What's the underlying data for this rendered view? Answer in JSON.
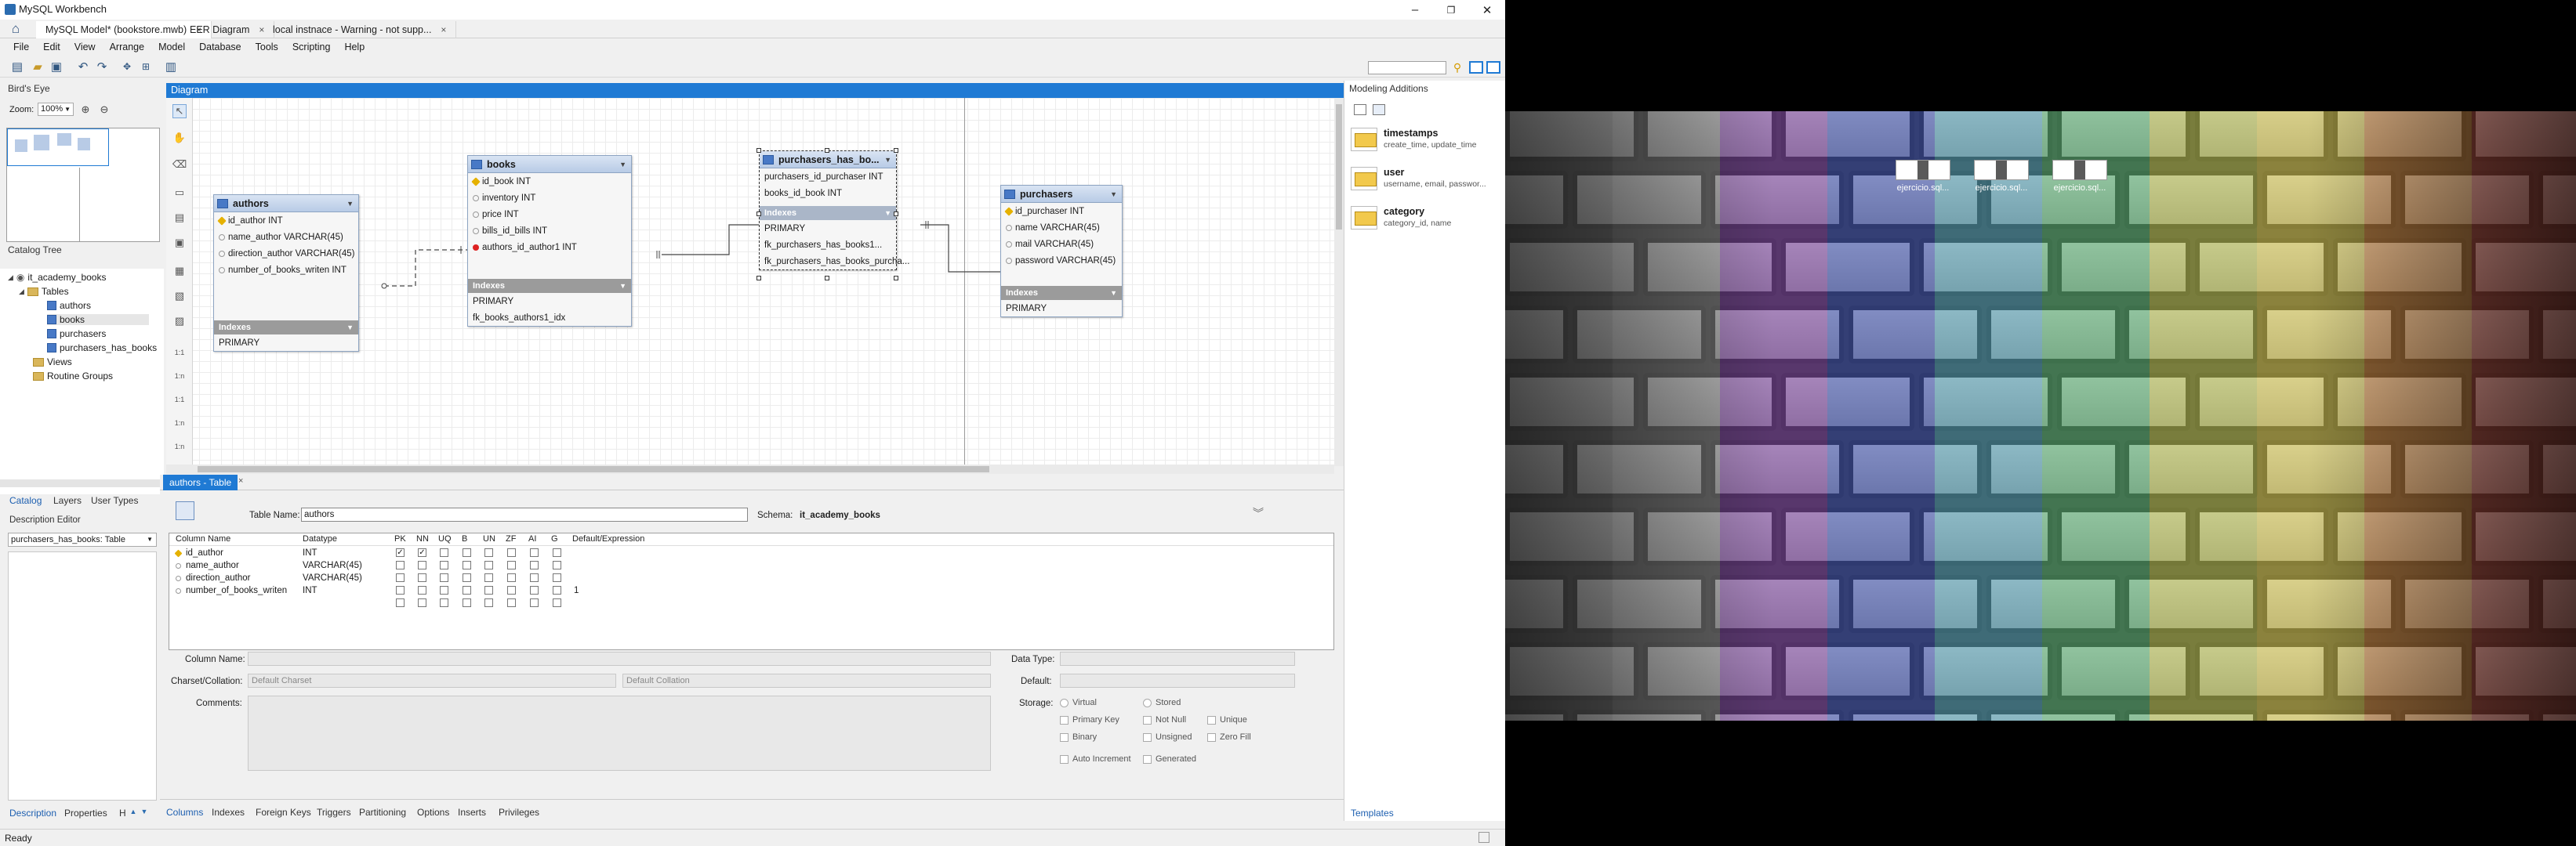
{
  "app": {
    "title": "MySQL Workbench"
  },
  "window_controls": {
    "minimize": "–",
    "restore": "❐",
    "close": "✕"
  },
  "doc_tabs": [
    {
      "label": "MySQL Model* (bookstore.mwb)",
      "close": "×"
    },
    {
      "label": "EER Diagram",
      "close": "×"
    },
    {
      "label": "local instnace - Warning - not supp...",
      "close": "×"
    }
  ],
  "menu": [
    "File",
    "Edit",
    "View",
    "Arrange",
    "Model",
    "Database",
    "Tools",
    "Scripting",
    "Help"
  ],
  "left": {
    "birds_eye_title": "Bird's Eye",
    "zoom_label": "Zoom:",
    "zoom_value": "100%",
    "catalog_title": "Catalog Tree",
    "tree": {
      "schema": "it_academy_books",
      "tables_folder": "Tables",
      "tables": [
        "authors",
        "books",
        "purchasers",
        "purchasers_has_books"
      ],
      "views": "Views",
      "routines": "Routine Groups"
    },
    "tabs": [
      "Catalog",
      "Layers",
      "User Types"
    ],
    "description_title": "Description Editor",
    "description_select": "purchasers_has_books: Table",
    "bottom_tabs": [
      "Description",
      "Properties",
      "H"
    ]
  },
  "diagram": {
    "title": "Diagram",
    "tables": {
      "authors": {
        "name": "authors",
        "columns": [
          "id_author INT",
          "name_author VARCHAR(45)",
          "direction_author VARCHAR(45)",
          "number_of_books_writen INT"
        ],
        "indexes_label": "Indexes",
        "indexes": [
          "PRIMARY"
        ]
      },
      "books": {
        "name": "books",
        "columns": [
          "id_book INT",
          "inventory INT",
          "price INT",
          "bills_id_bills INT",
          "authors_id_author1 INT"
        ],
        "indexes_label": "Indexes",
        "indexes": [
          "PRIMARY",
          "fk_books_authors1_idx"
        ]
      },
      "phb": {
        "name": "purchasers_has_bo...",
        "columns": [
          "purchasers_id_purchaser INT",
          "books_id_book INT"
        ],
        "indexes_label": "Indexes",
        "indexes": [
          "PRIMARY",
          "fk_purchasers_has_books1...",
          "fk_purchasers_has_books_purcha..."
        ]
      },
      "purchasers": {
        "name": "purchasers",
        "columns": [
          "id_purchaser INT",
          "name VARCHAR(45)",
          "mail VARCHAR(45)",
          "password VARCHAR(45)"
        ],
        "indexes_label": "Indexes",
        "indexes": [
          "PRIMARY"
        ]
      }
    },
    "rel_labels": [
      "1:1",
      "1:1",
      "1:n",
      "1:n",
      "1:n"
    ]
  },
  "editor": {
    "tab_label": "authors - Table",
    "table_name_label": "Table Name:",
    "table_name_value": "authors",
    "schema_label": "Schema:",
    "schema_value": "it_academy_books",
    "grid_headers": [
      "Column Name",
      "Datatype",
      "PK",
      "NN",
      "UQ",
      "B",
      "UN",
      "ZF",
      "AI",
      "G",
      "Default/Expression"
    ],
    "rows": [
      {
        "name": "id_author",
        "type": "INT",
        "pk": true,
        "nn": true,
        "default": ""
      },
      {
        "name": "name_author",
        "type": "VARCHAR(45)",
        "pk": false,
        "nn": false,
        "default": ""
      },
      {
        "name": "direction_author",
        "type": "VARCHAR(45)",
        "pk": false,
        "nn": false,
        "default": ""
      },
      {
        "name": "number_of_books_writen",
        "type": "INT",
        "pk": false,
        "nn": false,
        "default": "1"
      }
    ],
    "column_name_label": "Column Name:",
    "charset_label": "Charset/Collation:",
    "charset_value": "Default Charset",
    "collation_value": "Default Collation",
    "comments_label": "Comments:",
    "datatype_label": "Data Type:",
    "default_label": "Default:",
    "storage_label": "Storage:",
    "options": {
      "virtual": "Virtual",
      "stored": "Stored",
      "primary_key": "Primary Key",
      "not_null": "Not Null",
      "unique": "Unique",
      "binary": "Binary",
      "unsigned": "Unsigned",
      "zero_fill": "Zero Fill",
      "auto_increment": "Auto Increment",
      "generated": "Generated"
    },
    "tabs": [
      "Columns",
      "Indexes",
      "Foreign Keys",
      "Triggers",
      "Partitioning",
      "Options",
      "Inserts",
      "Privileges"
    ]
  },
  "right": {
    "title": "Modeling Additions",
    "snippets": [
      {
        "name": "timestamps",
        "desc": "create_time, update_time"
      },
      {
        "name": "user",
        "desc": "username, email, passwor..."
      },
      {
        "name": "category",
        "desc": "category_id, name"
      }
    ],
    "bottom_tab": "Templates"
  },
  "status": {
    "text": "Ready"
  },
  "desktop": {
    "icons": [
      "ejercicio.sql...",
      "ejercicio.sql...",
      "ejercicio.sql..."
    ]
  },
  "colors": {
    "accent": "#1f7ad4",
    "pk": "#e5b100",
    "table_header": "#b8cbe6"
  }
}
